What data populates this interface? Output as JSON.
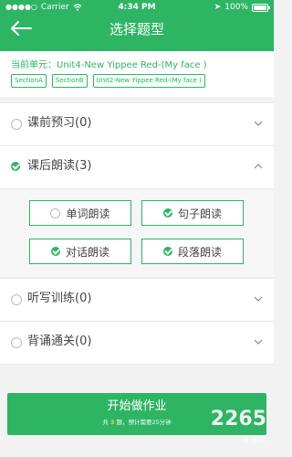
{
  "status_bar": {
    "carrier": "Carrier",
    "time": "4:34 PM",
    "battery": "100%"
  },
  "header": {
    "title": "选择题型"
  },
  "unit": {
    "prefix": "当前单元：",
    "name": "Unit4-New Yippee Red-(My face )"
  },
  "sections": [
    "SectionA",
    "SectionB",
    "Unit2-New Yippee Red-(My face )"
  ],
  "categories": [
    {
      "label": "课前预习(0)",
      "checked": false,
      "expanded": false
    },
    {
      "label": "课后朗读(3)",
      "checked": true,
      "expanded": true
    },
    {
      "label": "听写训练(0)",
      "checked": false,
      "expanded": false
    },
    {
      "label": "背诵通关(0)",
      "checked": false,
      "expanded": false
    }
  ],
  "sub_options": [
    {
      "label": "单词朗读",
      "checked": false
    },
    {
      "label": "句子朗读",
      "checked": true
    },
    {
      "label": "对话朗读",
      "checked": true
    },
    {
      "label": "段落朗读",
      "checked": true
    }
  ],
  "start_button": {
    "label": "开始做作业",
    "note_prefix": "共",
    "count": "3",
    "note_suffix": "题，预计需要25分钟"
  },
  "watermark": {
    "main": "2265",
    "sub": "手游网"
  },
  "colors": {
    "accent": "#2db564"
  }
}
